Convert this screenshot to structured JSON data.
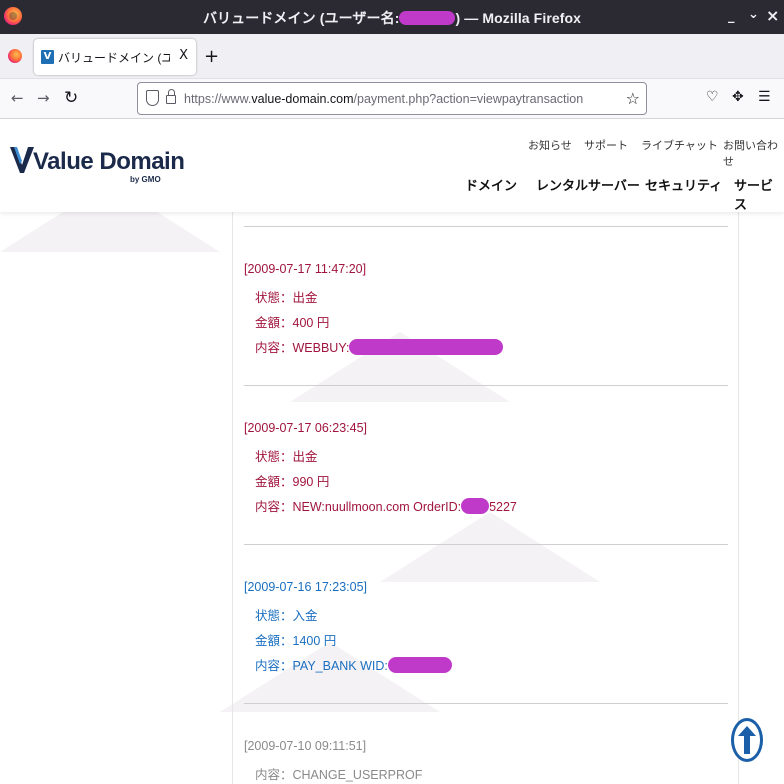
{
  "window": {
    "title_prefix": "バリュードメイン (ユーザー名:",
    "title_suffix": ") — Mozilla Firefox",
    "minimize": "_",
    "restore": "⌄",
    "close": "×"
  },
  "tabs": [
    {
      "label": "バリュードメイン (ユーザー",
      "close": "X"
    }
  ],
  "new_tab": "+",
  "address_bar": {
    "scheme": "https://www.",
    "host": "value-domain.com",
    "path": "/payment.php?action=viewpaytransaction"
  },
  "site": {
    "logo_text": "Value Domain",
    "logo_sub": "by GMO",
    "utility_links": [
      "お知らせ",
      "サポート",
      "ライブチャット",
      "お問い合わせ"
    ],
    "main_nav": [
      "ドメイン",
      "レンタルサーバー",
      "セキュリティ",
      "サービス"
    ]
  },
  "transactions": [
    {
      "timestamp": "[2009-07-17 11:47:20]",
      "status": "状態：出金",
      "amount": "金額：400 円",
      "detail": "内容：WEBBUY:",
      "detail_tail": "",
      "kind": "out"
    },
    {
      "timestamp": "[2009-07-17 06:23:45]",
      "status": "状態：出金",
      "amount": "金額：990 円",
      "detail": "内容：NEW:nuullmoon.com OrderID:",
      "detail_tail": "5227",
      "kind": "out"
    },
    {
      "timestamp": "[2009-07-16 17:23:05]",
      "status": "状態：入金",
      "amount": "金額：1400 円",
      "detail": "内容：PAY_BANK WID:",
      "detail_tail": "",
      "kind": "in"
    },
    {
      "timestamp": "[2009-07-10 09:11:51]",
      "detail": "内容：CHANGE_USERPROF",
      "kind": "info"
    }
  ],
  "colors": {
    "withdrawal": "#a0153e",
    "deposit": "#1a6fc1",
    "info": "#8a8a8a",
    "redaction": "#c03ac9"
  },
  "icons": [
    "firefox-icon",
    "back-icon",
    "forward-icon",
    "reload-icon",
    "shield-icon",
    "lock-icon",
    "bookmark-star-icon",
    "pocket-icon",
    "extensions-icon",
    "menu-icon",
    "scroll-to-top-icon"
  ]
}
